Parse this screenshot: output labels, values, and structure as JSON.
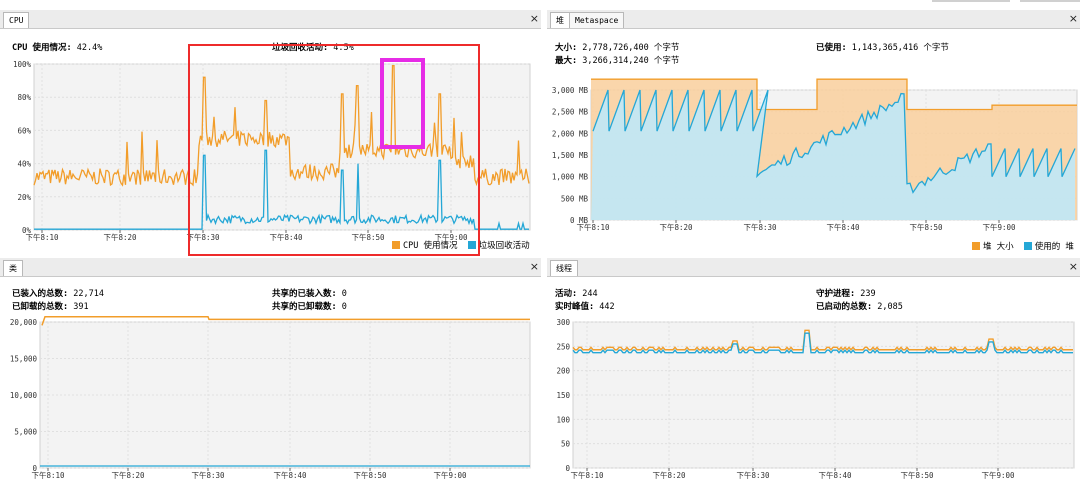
{
  "cpu": {
    "tab": "CPU",
    "usage_label": "CPU 使用情况:",
    "usage_value": "42.4%",
    "gc_label": "垃圾回收活动:",
    "gc_value": "4.5%",
    "legend": [
      "CPU 使用情况",
      "垃圾回收活动"
    ],
    "y_ticks": [
      "100%",
      "80%",
      "60%",
      "40%",
      "20%",
      "0%"
    ],
    "x_ticks": [
      "下午8:10",
      "下午8:20",
      "下午8:30",
      "下午8:40",
      "下午8:50",
      "下午9:00"
    ],
    "colors": {
      "cpu": "#f29d2a",
      "gc": "#24a7d6"
    }
  },
  "heap": {
    "tabs": [
      "堆",
      "Metaspace"
    ],
    "size_label": "大小:",
    "size_value": "2,778,726,400 个字节",
    "max_label": "最大:",
    "max_value": "3,266,314,240 个字节",
    "used_label": "已使用:",
    "used_value": "1,143,365,416 个字节",
    "legend": [
      "堆 大小",
      "使用的 堆"
    ],
    "y_ticks": [
      "3,000 MB",
      "2,500 MB",
      "2,000 MB",
      "1,500 MB",
      "1,000 MB",
      "500 MB",
      "0 MB"
    ],
    "x_ticks": [
      "下午8:10",
      "下午8:20",
      "下午8:30",
      "下午8:40",
      "下午8:50",
      "下午9:00"
    ],
    "colors": {
      "size": "#f29d2a",
      "used": "#24a7d6"
    }
  },
  "classes": {
    "tab": "类",
    "loaded_label": "已装入的总数:",
    "loaded_value": "22,714",
    "unloaded_label": "已卸载的总数:",
    "unloaded_value": "391",
    "shared_loaded_label": "共享的已装入数:",
    "shared_loaded_value": "0",
    "shared_unloaded_label": "共享的已卸载数:",
    "shared_unloaded_value": "0",
    "y_ticks": [
      "20,000",
      "15,000",
      "10,000",
      "5,000",
      "0"
    ],
    "x_ticks": [
      "下午8:10",
      "下午8:20",
      "下午8:30",
      "下午8:40",
      "下午8:50",
      "下午9:00"
    ]
  },
  "threads": {
    "tab": "线程",
    "live_label": "活动:",
    "live_value": "244",
    "peak_label": "实时峰值:",
    "peak_value": "442",
    "daemon_label": "守护进程:",
    "daemon_value": "239",
    "started_label": "已启动的总数:",
    "started_value": "2,085",
    "y_ticks": [
      "300",
      "250",
      "200",
      "150",
      "100",
      "50",
      "0"
    ],
    "x_ticks": [
      "下午8:10",
      "下午8:20",
      "下午8:30",
      "下午8:40",
      "下午8:50",
      "下午9:00"
    ]
  },
  "annotations": {
    "red_box_color": "#ee2b2b",
    "magenta_box_color": "#e62ce6"
  },
  "close_glyph": "×"
}
